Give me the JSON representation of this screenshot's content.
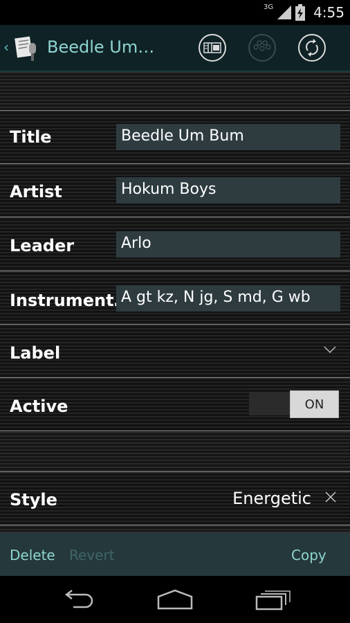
{
  "status": {
    "network": "3G",
    "time": "4:55"
  },
  "actionbar": {
    "title": "Beedle Um…",
    "icons": [
      "up-chevron-icon",
      "app-logo-icon",
      "layout-icon",
      "bubbles-icon",
      "sync-icon"
    ]
  },
  "form": {
    "title_label": "Title",
    "title_value": "Beedle Um Bum",
    "artist_label": "Artist",
    "artist_value": "Hokum Boys",
    "leader_label": "Leader",
    "leader_value": "Arlo",
    "instruments_label": "Instrument…",
    "instruments_value": "A gt kz, N jg, S md, G wb",
    "label_label": "Label",
    "active_label": "Active",
    "active_state": "ON",
    "style_label": "Style",
    "style_value": "Energetic"
  },
  "bottombar": {
    "delete": "Delete",
    "revert": "Revert",
    "copy": "Copy"
  },
  "colors": {
    "accent": "#8fd5d1",
    "disabled": "#3f6668",
    "field_bg": "#2e3c40"
  }
}
